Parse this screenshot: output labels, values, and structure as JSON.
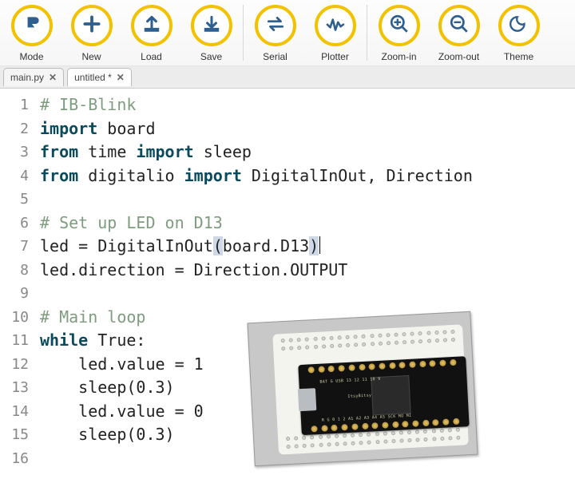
{
  "toolbar": [
    {
      "icon": "mode",
      "label": "Mode"
    },
    {
      "icon": "new",
      "label": "New"
    },
    {
      "icon": "load",
      "label": "Load"
    },
    {
      "icon": "save",
      "label": "Save"
    },
    {
      "sep": true
    },
    {
      "icon": "serial",
      "label": "Serial"
    },
    {
      "icon": "plotter",
      "label": "Plotter"
    },
    {
      "sep": true
    },
    {
      "icon": "zoom-in",
      "label": "Zoom-in"
    },
    {
      "icon": "zoom-out",
      "label": "Zoom-out"
    },
    {
      "icon": "theme",
      "label": "Theme"
    }
  ],
  "tabs": [
    {
      "name": "main.py",
      "dirty": false,
      "active": false
    },
    {
      "name": "untitled *",
      "dirty": true,
      "active": true
    }
  ],
  "code": {
    "lines": [
      [
        {
          "t": "# IB-Blink",
          "c": "com"
        }
      ],
      [
        {
          "t": "import",
          "c": "kw"
        },
        {
          "t": " board",
          "c": "name"
        }
      ],
      [
        {
          "t": "from",
          "c": "kw"
        },
        {
          "t": " time ",
          "c": "name"
        },
        {
          "t": "import",
          "c": "kw"
        },
        {
          "t": " sleep",
          "c": "name"
        }
      ],
      [
        {
          "t": "from",
          "c": "kw"
        },
        {
          "t": " digitalio ",
          "c": "name"
        },
        {
          "t": "import",
          "c": "kw"
        },
        {
          "t": " DigitalInOut, Direction",
          "c": "name"
        }
      ],
      [],
      [
        {
          "t": "# Set up LED on D13",
          "c": "com"
        }
      ],
      [
        {
          "t": "led = DigitalInOut",
          "c": "name"
        },
        {
          "t": "(",
          "c": "par",
          "hl": true
        },
        {
          "t": "board.D13",
          "c": "name"
        },
        {
          "t": ")",
          "c": "par",
          "hl": true
        },
        {
          "cursor": true
        }
      ],
      [
        {
          "t": "led.direction = Direction.OUTPUT",
          "c": "name"
        }
      ],
      [],
      [
        {
          "t": "# Main loop",
          "c": "com"
        }
      ],
      [
        {
          "t": "while",
          "c": "kw"
        },
        {
          "t": " True:",
          "c": "name"
        }
      ],
      [
        {
          "t": "    led.value = ",
          "c": "name"
        },
        {
          "t": "1",
          "c": "num"
        }
      ],
      [
        {
          "t": "    sleep(",
          "c": "name"
        },
        {
          "t": "0.3",
          "c": "num"
        },
        {
          "t": ")",
          "c": "name"
        }
      ],
      [
        {
          "t": "    led.value = ",
          "c": "name"
        },
        {
          "t": "0",
          "c": "num"
        }
      ],
      [
        {
          "t": "    sleep(",
          "c": "name"
        },
        {
          "t": "0.3",
          "c": "num"
        },
        {
          "t": ")",
          "c": "name"
        }
      ],
      []
    ]
  }
}
